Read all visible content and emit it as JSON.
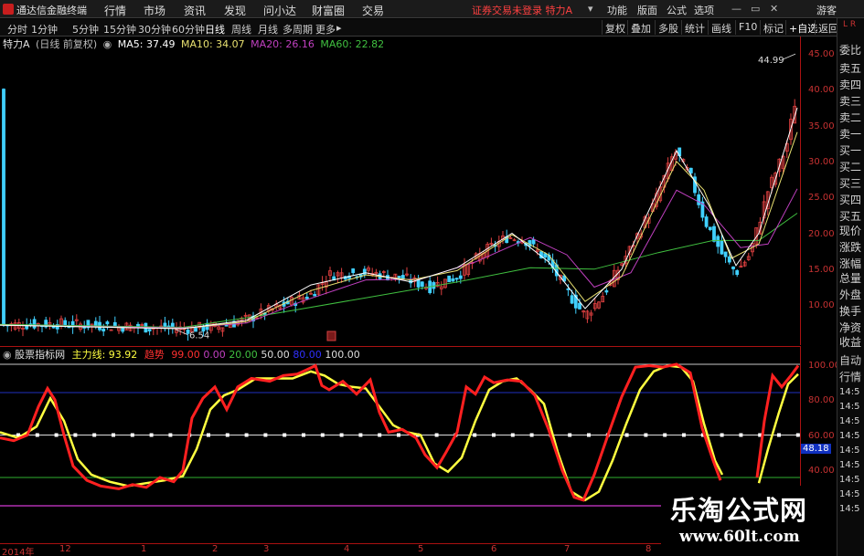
{
  "menubar": {
    "app_title": "通达信金融终端",
    "items": [
      "行情",
      "市场",
      "资讯",
      "发现",
      "问小达",
      "财富圈",
      "交易"
    ],
    "warning": "证券交易未登录 特力A",
    "right_items": [
      "功能",
      "版面",
      "公式",
      "选项"
    ],
    "guest": "游客"
  },
  "periods": [
    "分时",
    "1分钟",
    "5分钟",
    "15分钟",
    "30分钟",
    "60分钟",
    "日线",
    "周线",
    "月线",
    "多周期",
    "更多"
  ],
  "active_period": "日线",
  "toolbar_right": [
    "复权",
    "叠加",
    "多股",
    "统计",
    "画线",
    "F10",
    "标记",
    "+自选",
    "返回"
  ],
  "info": {
    "stock": "特力A",
    "mode": "(日线 前复权)",
    "ma5": "MA5: 37.49",
    "ma10": "MA10: 34.07",
    "ma20": "MA20: 26.16",
    "ma60": "MA60: 22.82"
  },
  "colors": {
    "ma5": "#ffffff",
    "ma10": "#e8e070",
    "ma20": "#c040c0",
    "ma60": "#40c040",
    "up": "#e04040",
    "down": "#40d0ff",
    "main_line": "#ff2020",
    "trend_line": "#ffff40",
    "axis": "#c83232"
  },
  "main_axis": [
    "45.00",
    "40.00",
    "35.00",
    "30.00",
    "25.00",
    "20.00",
    "15.00",
    "10.00"
  ],
  "price_high_label": "44.99",
  "price_low_label": "6.54",
  "indicator": {
    "name": "股票指标网",
    "main_label": "主力线: 93.92",
    "trend_label": "趋势",
    "levels": [
      "99.00",
      "0.00",
      "20.00",
      "50.00",
      "80.00",
      "100.00"
    ],
    "axis": [
      "100.00",
      "80.00",
      "60.00",
      "40.00"
    ],
    "current_value": "48.18"
  },
  "side_panel": [
    "委比",
    "卖五",
    "卖四",
    "卖三",
    "卖二",
    "卖一",
    "买一",
    "买二",
    "买三",
    "买四",
    "买五",
    "现价",
    "涨跌",
    "涨幅",
    "总量",
    "外盘",
    "换手",
    "净资",
    "收益"
  ],
  "side_tabs": [
    "自动",
    "行情"
  ],
  "side_times": [
    "14:5",
    "14:5",
    "14:5",
    "14:5",
    "14:5",
    "14:5",
    "14:5",
    "14:5",
    "14:5"
  ],
  "dates": [
    "2014年",
    "12",
    "1",
    "2",
    "3",
    "4",
    "5",
    "6",
    "7",
    "8"
  ],
  "watermark": {
    "title": "乐淘公式网",
    "url": "www.60lt.com"
  }
}
